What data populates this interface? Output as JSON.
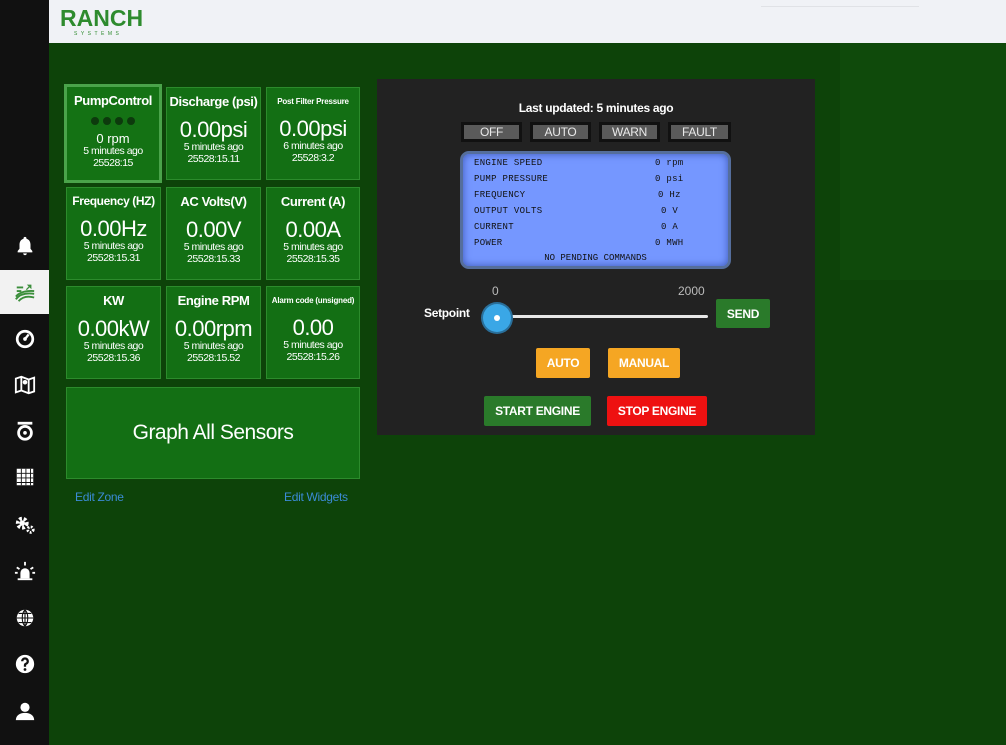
{
  "header": {
    "logo_main": "RANCH",
    "logo_sub": "SYSTEMS"
  },
  "sidebar": {
    "items": [
      {
        "icon": "bell-icon"
      },
      {
        "icon": "field-icon",
        "active": true
      },
      {
        "icon": "gauge-icon"
      },
      {
        "icon": "map-icon"
      },
      {
        "icon": "tank-icon"
      },
      {
        "icon": "grid-icon"
      },
      {
        "icon": "gears-icon"
      },
      {
        "icon": "alarm-icon"
      },
      {
        "icon": "globe-icon"
      },
      {
        "icon": "help-icon"
      },
      {
        "icon": "user-icon"
      }
    ]
  },
  "widgets": {
    "pump": {
      "title": "PumpControl",
      "rpm": "0 rpm",
      "ago": "5 minutes ago",
      "time": "25528:15"
    },
    "discharge": {
      "title": "Discharge (psi)",
      "value": "0.00psi",
      "ago": "5 minutes ago",
      "time": "25528:15.11"
    },
    "post_filter": {
      "title": "Post Filter Pressure",
      "value": "0.00psi",
      "ago": "6 minutes ago",
      "time": "25528:3.2"
    },
    "frequency": {
      "title": "Frequency (HZ)",
      "value": "0.00Hz",
      "ago": "5 minutes ago",
      "time": "25528:15.31"
    },
    "ac_volts": {
      "title": "AC Volts(V)",
      "value": "0.00V",
      "ago": "5 minutes ago",
      "time": "25528:15.33"
    },
    "current": {
      "title": "Current (A)",
      "value": "0.00A",
      "ago": "5 minutes ago",
      "time": "25528:15.35"
    },
    "kw": {
      "title": "KW",
      "value": "0.00kW",
      "ago": "5 minutes ago",
      "time": "25528:15.36"
    },
    "engine_rpm": {
      "title": "Engine RPM",
      "value": "0.00rpm",
      "ago": "5 minutes ago",
      "time": "25528:15.52"
    },
    "alarm_code": {
      "title": "Alarm code (unsigned)",
      "value": "0.00",
      "ago": "5 minutes ago",
      "time": "25528:15.26"
    },
    "graph_all": "Graph All Sensors",
    "edit_zone": "Edit Zone",
    "edit_widgets": "Edit Widgets"
  },
  "panel": {
    "last_updated": "Last updated: 5 minutes ago",
    "states": [
      "OFF",
      "AUTO",
      "WARN",
      "FAULT"
    ],
    "lcd": {
      "rows": [
        {
          "label": "ENGINE SPEED",
          "value": "0 rpm"
        },
        {
          "label": "PUMP PRESSURE",
          "value": "0 psi"
        },
        {
          "label": "FREQUENCY",
          "value": "0 Hz"
        },
        {
          "label": "OUTPUT VOLTS",
          "value": "0 V"
        },
        {
          "label": "CURRENT",
          "value": "0 A"
        },
        {
          "label": "POWER",
          "value": "0 MWH"
        }
      ],
      "footer": "NO PENDING COMMANDS"
    },
    "setpoint": {
      "label": "Setpoint",
      "min": "0",
      "max": "2000",
      "value": 0
    },
    "send": "SEND",
    "auto": "AUTO",
    "manual": "MANUAL",
    "start": "START ENGINE",
    "stop": "STOP ENGINE"
  },
  "colors": {
    "background": "#0d4309",
    "tile": "#136f14",
    "sidebar": "#111111",
    "accent_green": "#2e8b2e",
    "orange": "#f5a623",
    "red": "#ee1111",
    "lcd": "#7597ff"
  }
}
